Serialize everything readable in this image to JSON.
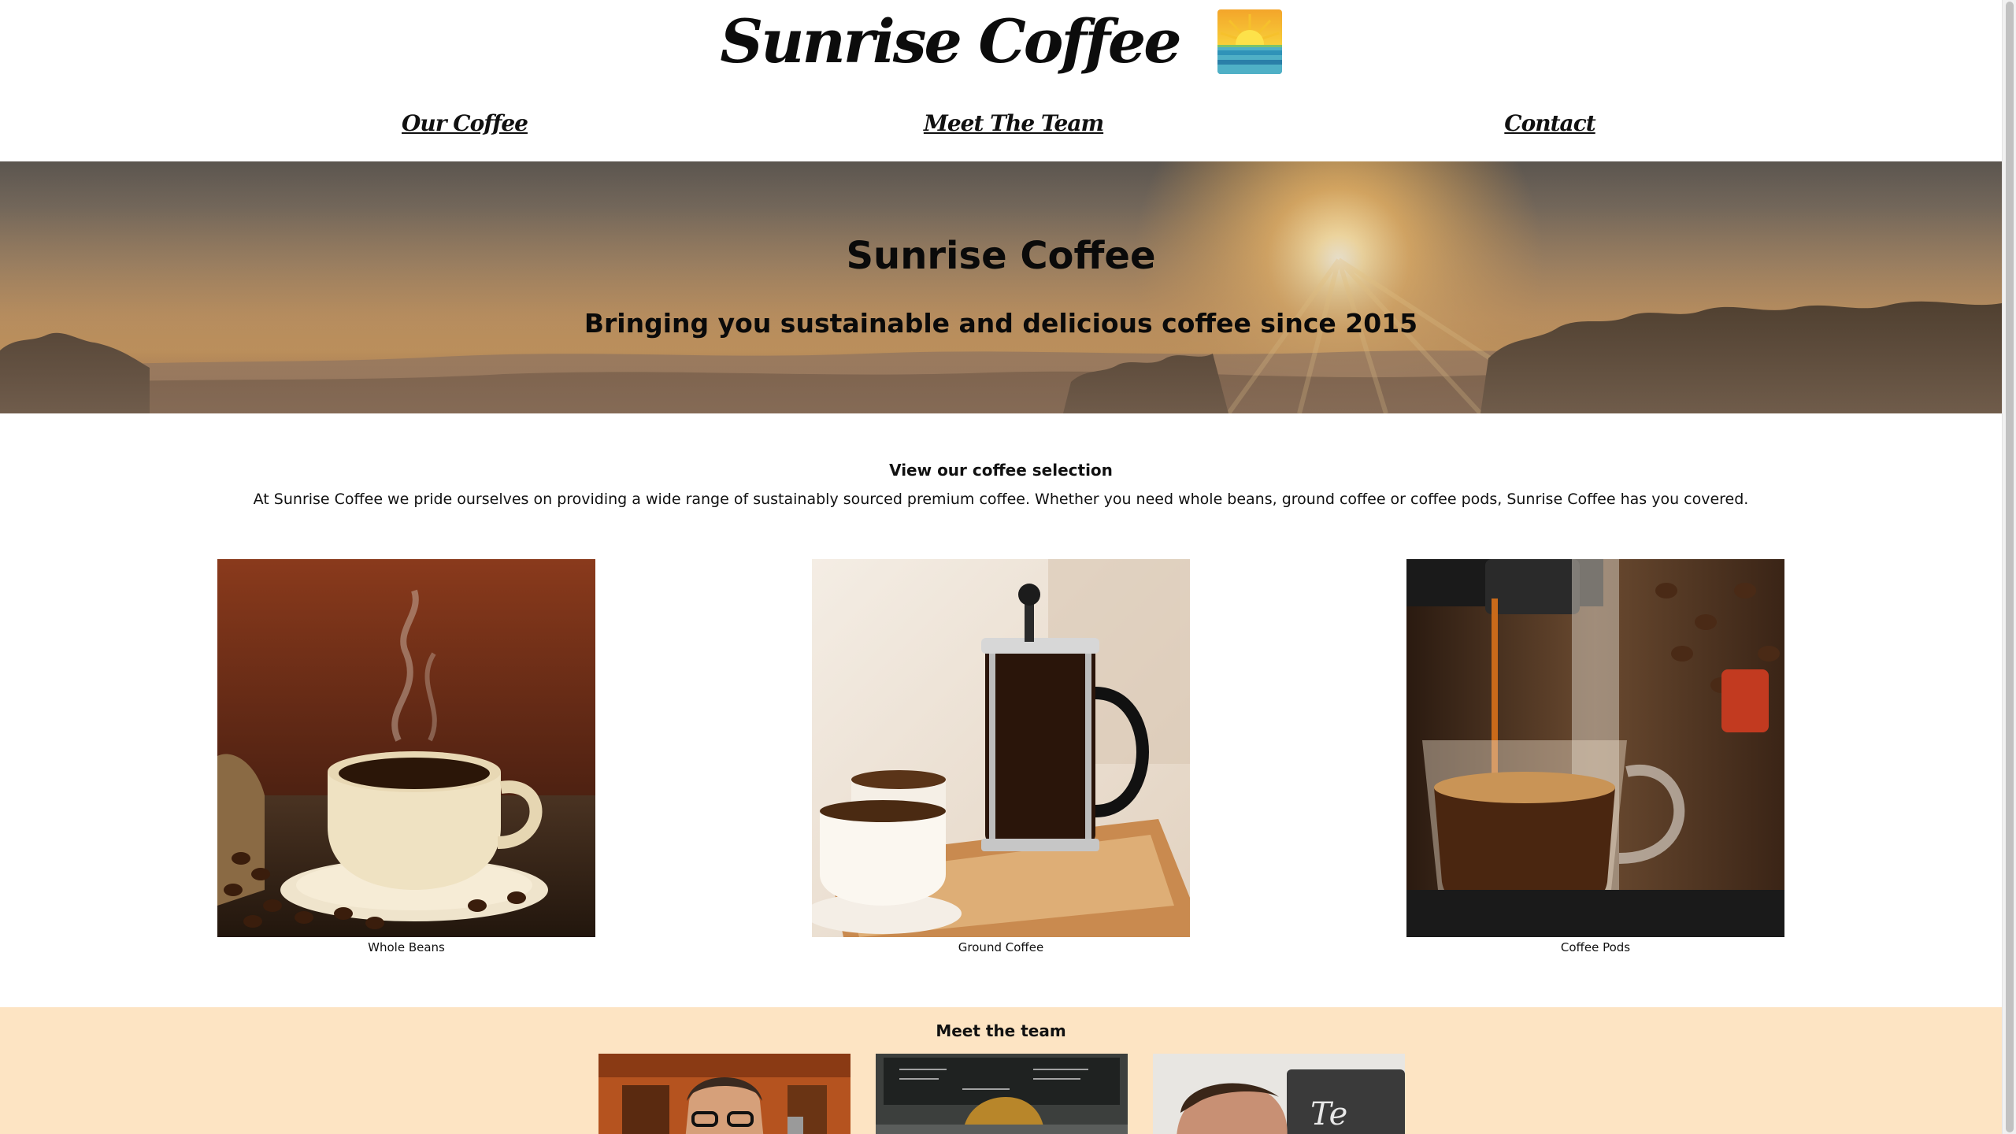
{
  "header": {
    "brand_title": "Sunrise Coffee",
    "logo_icon": "sunrise-logo-icon",
    "nav": [
      {
        "label": "Our Coffee"
      },
      {
        "label": "Meet The Team"
      },
      {
        "label": "Contact"
      }
    ]
  },
  "hero": {
    "title": "Sunrise Coffee",
    "subtitle": "Bringing you sustainable and delicious coffee since 2015"
  },
  "selection": {
    "heading": "View our coffee selection",
    "text": "At Sunrise Coffee we pride ourselves on providing a wide range of sustainably sourced premium coffee. Whether you need whole beans, ground coffee or coffee pods, Sunrise Coffee has you covered.",
    "products": [
      {
        "caption": "Whole Beans"
      },
      {
        "caption": "Ground Coffee"
      },
      {
        "caption": "Coffee Pods"
      }
    ]
  },
  "team": {
    "heading": "Meet the team"
  },
  "colors": {
    "team_background": "#fde4c3",
    "hero_orange": "#d79a4c"
  }
}
